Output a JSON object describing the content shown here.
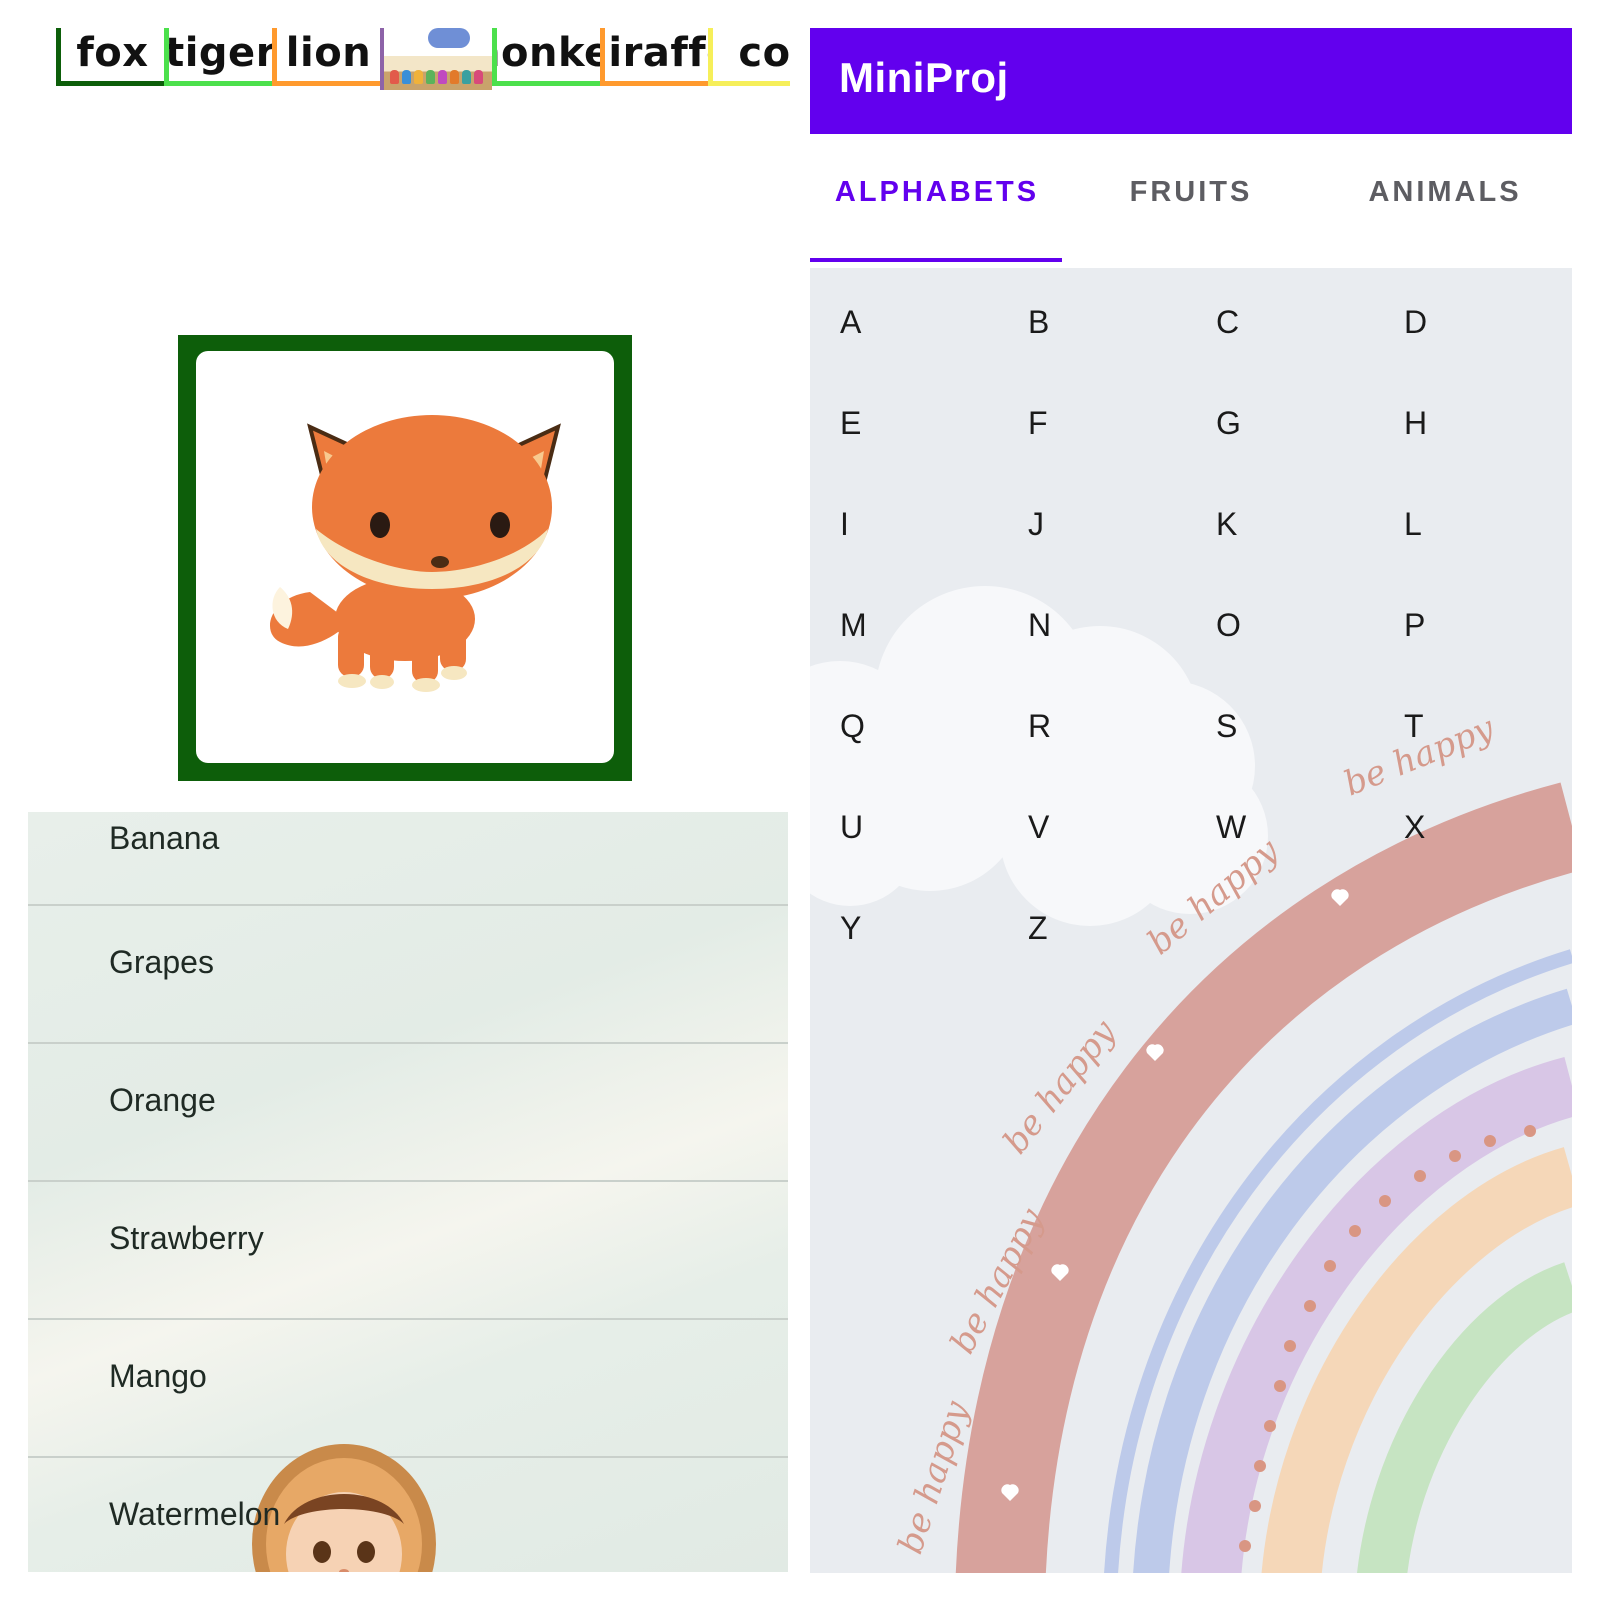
{
  "animal_strip": {
    "cards": [
      {
        "label": "fox",
        "border": "#0d5e0a"
      },
      {
        "label": "tiger",
        "border": "#4ce04c"
      },
      {
        "label": "lion",
        "border": "#ff9a2e"
      },
      {
        "label": "",
        "picture": true
      },
      {
        "label": "monkey",
        "border": "#4ce04c"
      },
      {
        "label": "giraffe",
        "border": "#ff9a2e"
      },
      {
        "label": "co",
        "border": "#f6ef5a"
      }
    ]
  },
  "selected_animal": {
    "icon": "fox-illustration",
    "frame_color": "#0d5e0a"
  },
  "fruits": [
    "Banana",
    "Grapes",
    "Orange",
    "Strawberry",
    "Mango",
    "Watermelon"
  ],
  "app": {
    "title": "MiniProj",
    "accent": "#6200ee",
    "tabs": [
      {
        "label": "ALPHABETS",
        "active": true
      },
      {
        "label": "FRUITS",
        "active": false
      },
      {
        "label": "ANIMALS",
        "active": false
      }
    ],
    "alphabet": [
      "A",
      "B",
      "C",
      "D",
      "E",
      "F",
      "G",
      "H",
      "I",
      "J",
      "K",
      "L",
      "M",
      "N",
      "O",
      "P",
      "Q",
      "R",
      "S",
      "T",
      "U",
      "V",
      "W",
      "X",
      "Y",
      "Z"
    ],
    "wallpaper_text": "be happy"
  }
}
